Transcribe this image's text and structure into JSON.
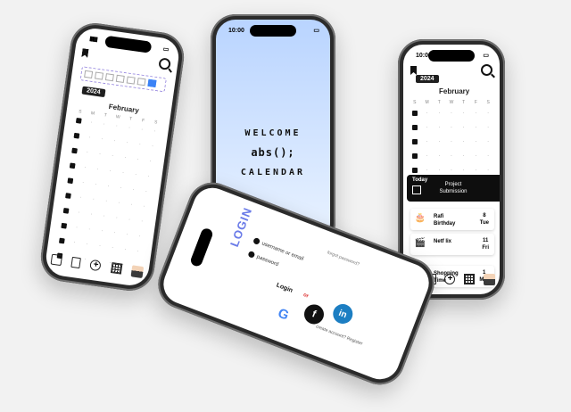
{
  "status": {
    "time": "10:00"
  },
  "welcome": {
    "line1": "WELCOME",
    "line2": "abs();",
    "line3": "CALENDAR"
  },
  "calendar": {
    "year": "2024",
    "month": "February",
    "weekdays": [
      "S",
      "M",
      "T",
      "W",
      "T",
      "F",
      "S"
    ],
    "filter_chips": [
      "a",
      "b",
      "c",
      "d",
      "e",
      "f",
      "g"
    ]
  },
  "events": {
    "today_label": "Today",
    "today_title": "Project Submission",
    "items": [
      {
        "icon": "cake-icon",
        "glyph": "🎂",
        "name": "Rafi Birthday",
        "day": "8",
        "dow": "Tue"
      },
      {
        "icon": "clapper-icon",
        "glyph": "🎬",
        "name": "Netf lix",
        "day": "11",
        "dow": "Fri"
      },
      {
        "icon": "cart-icon",
        "glyph": "🛒",
        "name": "Shopping Time",
        "day": "1",
        "dow": "Mar"
      }
    ]
  },
  "login": {
    "title": "LOGIN",
    "username_placeholder": "username or email",
    "password_placeholder": "password",
    "forgot": "forgot password?",
    "button": "Login",
    "or": "or",
    "social": {
      "google": "G",
      "facebook": "f",
      "linkedin": "in"
    },
    "signup": "create account? Register"
  },
  "colors": {
    "accent": "#6a7be8",
    "welcome_bg": "#b9d4ff",
    "linkedin": "#1c7ec2"
  }
}
